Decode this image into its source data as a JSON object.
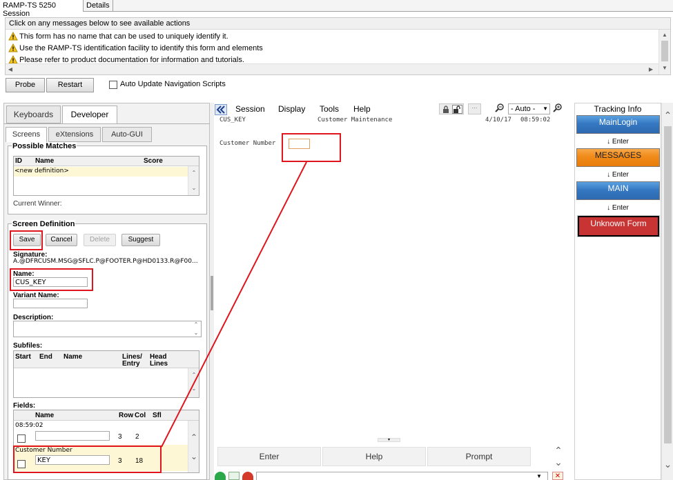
{
  "tabs": [
    "RAMP-TS 5250 Session",
    "Details"
  ],
  "messages": {
    "header": "Click on any messages below to see available actions",
    "items": [
      "This form has no name that can be used to uniquely identify it.",
      "Use the RAMP-TS identification facility to identify this form and elements",
      "Please refer to product documentation for information and tutorials."
    ]
  },
  "toolbar": {
    "probe": "Probe",
    "restart": "Restart",
    "auto_update_label": "Auto Update Navigation Scripts",
    "auto_update_checked": false
  },
  "left_panel": {
    "tabs": [
      "Keyboards",
      "Developer"
    ],
    "active_tab": "Developer",
    "subtabs": [
      "Screens",
      "eXtensions",
      "Auto-GUI"
    ],
    "active_subtab": "Screens",
    "possible_matches": {
      "title": "Possible Matches",
      "columns": [
        "ID",
        "Name",
        "Score"
      ],
      "rows": [
        "<new definition>"
      ],
      "current_winner_label": "Current Winner:"
    },
    "screen_definition": {
      "title": "Screen Definition",
      "buttons": {
        "save": "Save",
        "cancel": "Cancel",
        "delete": "Delete",
        "suggest": "Suggest"
      },
      "signature_label": "Signature:",
      "signature_value": "A.@DFRCUSM.MSG@SFLC.P@FOOTER.P@HD0133.R@F00...",
      "name_label": "Name:",
      "name_value": "CUS_KEY",
      "variant_label": "Variant Name:",
      "variant_value": "",
      "description_label": "Description:",
      "description_value": "",
      "subfiles_label": "Subfiles:",
      "subfile_columns": {
        "start": "Start",
        "end": "End",
        "name": "Name",
        "lines": "Lines/",
        "lines2": "Entry",
        "head": "Head",
        "head2": "Lines"
      },
      "fields_label": "Fields:",
      "field_columns": {
        "name": "Name",
        "row": "Row",
        "col": "Col",
        "sfl": "Sfl"
      },
      "fields": [
        {
          "caption": "08:59:02",
          "name": "",
          "row": "3",
          "col": "2",
          "sfl": ""
        },
        {
          "caption": "Customer Number",
          "name": "KEY",
          "row": "3",
          "col": "18",
          "sfl": ""
        }
      ]
    }
  },
  "session": {
    "menu": [
      "Session",
      "Display",
      "Tools",
      "Help"
    ],
    "mode_select": "- Auto -",
    "screen_id": "CUS_KEY",
    "screen_title": "Customer Maintenance",
    "date": "4/10/17",
    "time": "08:59:02",
    "field_label": "Customer Number",
    "field_value": "",
    "buttons": [
      "Enter",
      "Help",
      "Prompt"
    ]
  },
  "tracking": {
    "title": "Tracking Info",
    "steps": [
      {
        "label": "MainLogin",
        "color": "#3578c2"
      },
      {
        "label": "MESSAGES",
        "color": "#f08a18"
      },
      {
        "label": "MAIN",
        "color": "#3578c2"
      },
      {
        "label": "Unknown Form",
        "color": "#c83434"
      }
    ],
    "connector": "↓ Enter"
  }
}
